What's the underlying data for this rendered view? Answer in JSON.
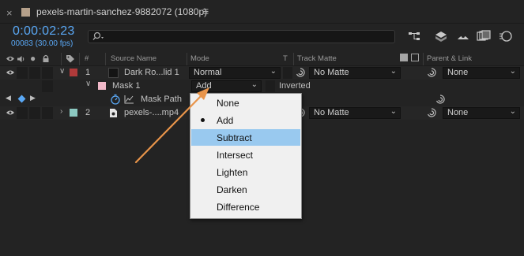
{
  "tab": {
    "close_glyph": "×",
    "title": "pexels-martin-sanchez-9882072 (1080p)",
    "menu_glyph": "≡",
    "swatch_color": "#b5a08a"
  },
  "time": {
    "timecode": "0:00:02:23",
    "frames": "00083 (30.00 fps)"
  },
  "search": {
    "placeholder": ""
  },
  "columns": {
    "hash": "#",
    "source_name": "Source Name",
    "mode": "Mode",
    "t": "T",
    "track_matte": "Track Matte",
    "parent_link": "Parent & Link"
  },
  "layers": [
    {
      "number": "1",
      "name": "Dark Ro...lid 1",
      "label_color": "#b03a3a",
      "mode": "Normal",
      "track_matte": "No Matte",
      "parent": "None"
    },
    {
      "number": "2",
      "name": "pexels-....mp4",
      "label_color": "#8cc9c1",
      "mode": "",
      "track_matte": "No Matte",
      "parent": "None"
    }
  ],
  "mask": {
    "name": "Mask 1",
    "swatch_color": "#f0b8c8",
    "mode": "Add",
    "inverted_label": "Inverted",
    "path_label": "Mask Path"
  },
  "mode_menu": {
    "selected": "Add",
    "highlighted": "Subtract",
    "items": [
      "None",
      "Add",
      "Subtract",
      "Intersect",
      "Lighten",
      "Darken",
      "Difference"
    ]
  },
  "colors": {
    "accent_blue": "#5aa8f5",
    "highlight": "#99c9ef",
    "arrow": "#e8944a"
  }
}
